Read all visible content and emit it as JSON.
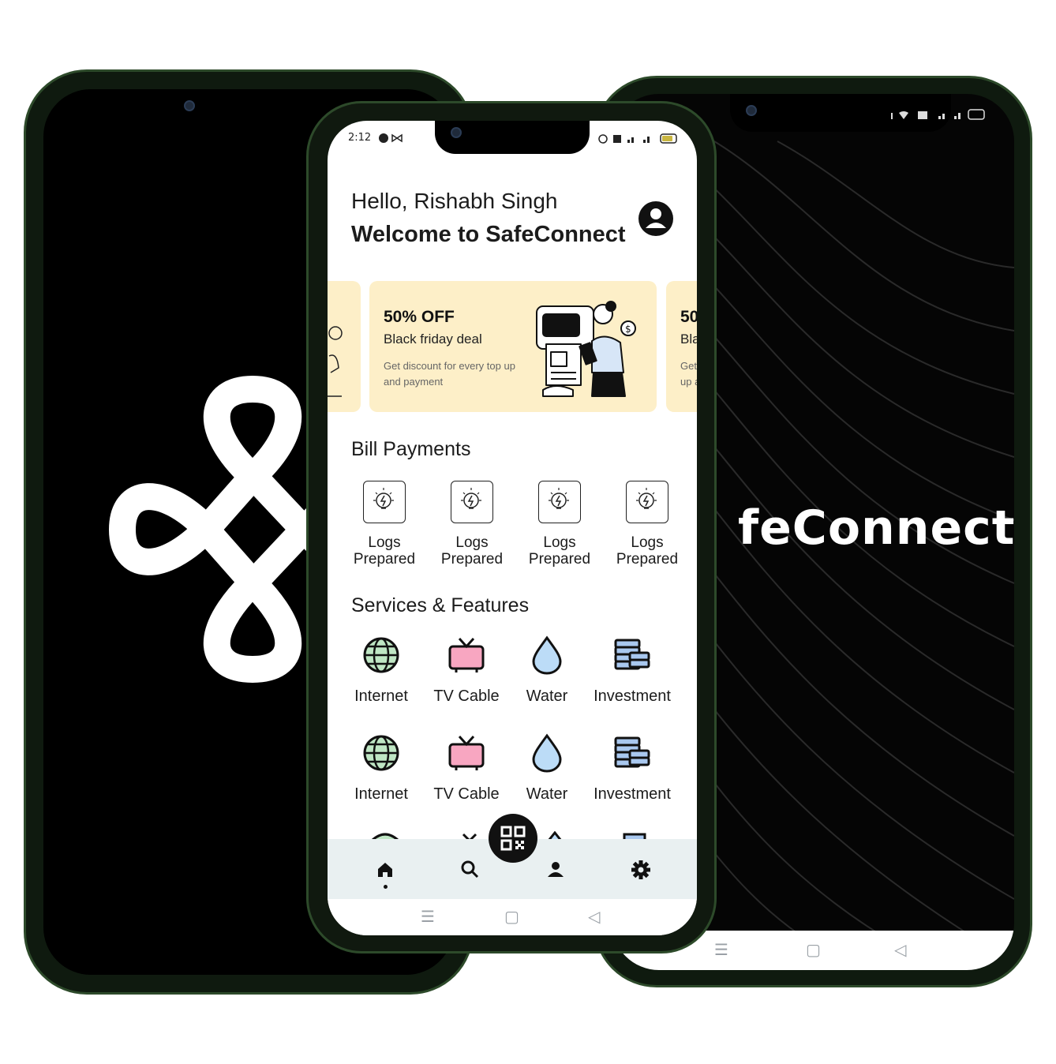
{
  "status_bar": {
    "time": "2:12"
  },
  "home": {
    "greeting": "Hello, Rishabh Singh",
    "welcome": "Welcome to SafeConnect"
  },
  "promo": {
    "title": "50% OFF",
    "subtitle": "Black friday deal",
    "description": "Get discount for every top up and payment",
    "peek_title": "50",
    "peek_subtitle": "Bla",
    "peek_desc": "Get up a"
  },
  "bill_payments": {
    "title": "Bill Payments",
    "items": [
      {
        "line1": "Logs",
        "line2": "Prepared",
        "icon": "bulb-icon"
      },
      {
        "line1": "Logs",
        "line2": "Prepared",
        "icon": "bulb-icon"
      },
      {
        "line1": "Logs",
        "line2": "Prepared",
        "icon": "bulb-icon"
      },
      {
        "line1": "Logs",
        "line2": "Prepared",
        "icon": "bulb-icon"
      }
    ]
  },
  "services": {
    "title": "Services & Features",
    "row1": [
      {
        "label": "Internet",
        "icon": "globe-icon"
      },
      {
        "label": "TV Cable",
        "icon": "tv-icon"
      },
      {
        "label": "Water",
        "icon": "water-drop-icon"
      },
      {
        "label": "Investment",
        "icon": "coins-icon"
      }
    ],
    "row2": [
      {
        "label": "Internet",
        "icon": "globe-icon"
      },
      {
        "label": "TV Cable",
        "icon": "tv-icon"
      },
      {
        "label": "Water",
        "icon": "water-drop-icon"
      },
      {
        "label": "Investment",
        "icon": "coins-icon"
      }
    ]
  },
  "bottom_nav": [
    "home-icon",
    "search-icon",
    "qr-icon",
    "profile-icon",
    "settings-icon"
  ],
  "splash": {
    "wordmark": "feConnect"
  },
  "colors": {
    "banner": "#fdefc8",
    "bottom_bar": "#e9f0f1",
    "frame": "#2d4a2a"
  }
}
